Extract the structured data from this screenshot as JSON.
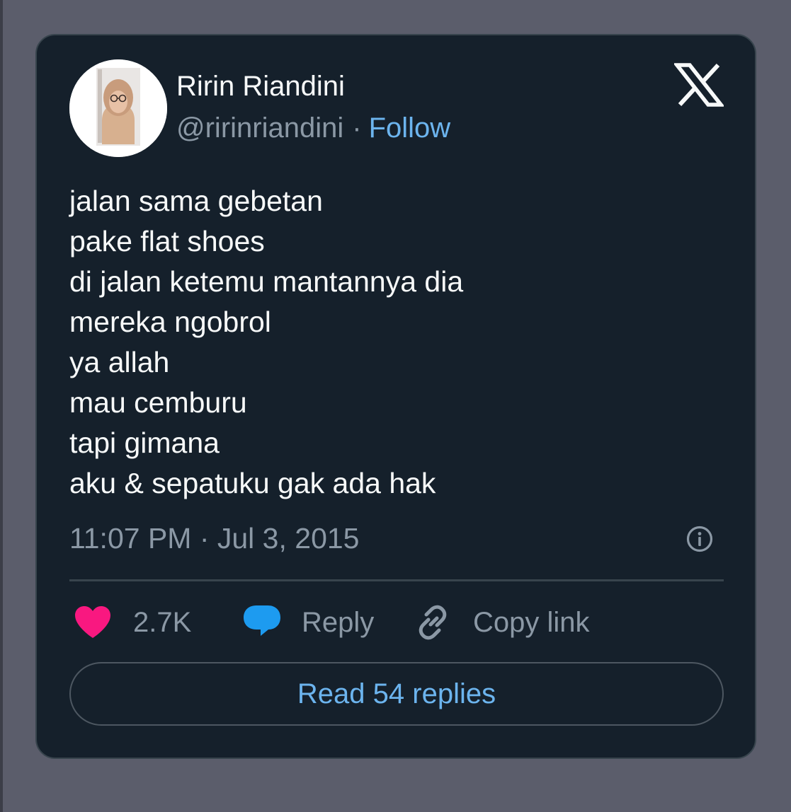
{
  "author": {
    "display_name": "Ririn Riandini",
    "handle": "@ririnriandini",
    "separator": "·",
    "follow_label": "Follow"
  },
  "tweet": {
    "lines": [
      "jalan sama gebetan",
      "pake flat shoes",
      "di jalan ketemu mantannya dia",
      "mereka ngobrol",
      "ya allah",
      "mau cemburu",
      "tapi gimana",
      "aku & sepatuku gak ada hak"
    ],
    "timestamp": "11:07 PM · Jul 3, 2015"
  },
  "actions": {
    "like_count": "2.7K",
    "reply_label": "Reply",
    "copy_link_label": "Copy link"
  },
  "read_replies_label": "Read 54 replies",
  "icons": {
    "brand": "x-logo-icon",
    "info": "info-icon",
    "like": "heart-icon",
    "reply": "speech-bubble-icon",
    "copy": "link-icon"
  },
  "colors": {
    "page_background": "#5b5d6b",
    "card_background": "#15202b",
    "border": "#38444d",
    "text_primary": "#f7f9f9",
    "text_secondary": "#8b98a5",
    "link": "#6cb4ee",
    "heart": "#f91880",
    "reply_bubble": "#1d9bf0"
  }
}
